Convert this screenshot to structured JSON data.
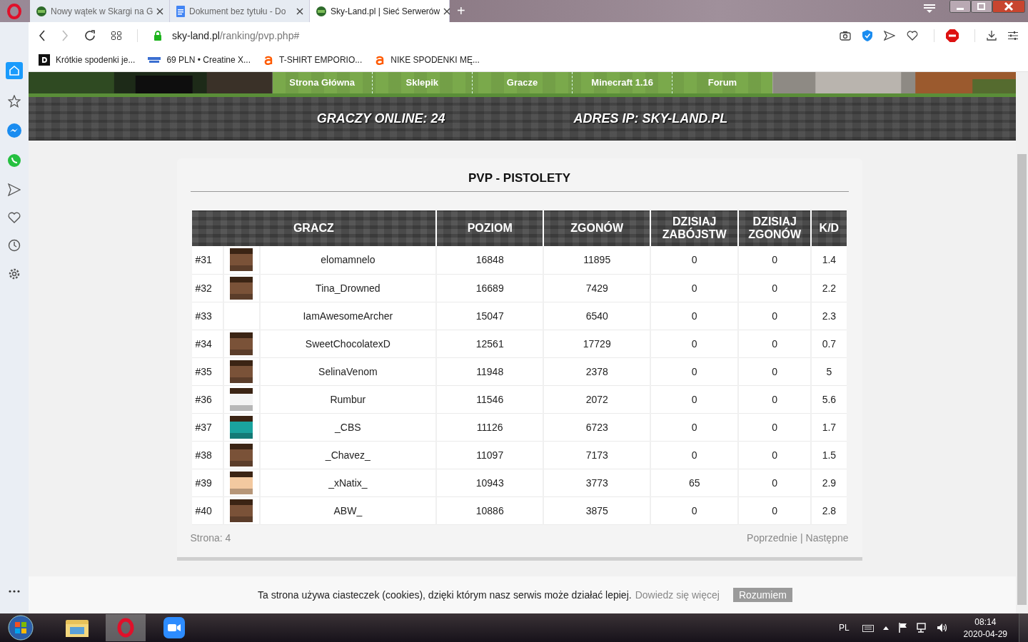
{
  "browser": {
    "tabs": [
      {
        "title": "Nowy wątek w Skargi na G",
        "selected": false
      },
      {
        "title": "Dokument bez tytułu - Do",
        "selected": false
      },
      {
        "title": "Sky-Land.pl | Sieć Serwerów",
        "selected": true
      }
    ],
    "new_tab": "+",
    "address": {
      "host": "sky-land.pl",
      "path": "/ranking/pvp.php#"
    },
    "bookmarks": [
      {
        "title": "Krótkie spodenki je...",
        "kind": "d"
      },
      {
        "title": "69 PLN • Creatine X...",
        "kind": "shop"
      },
      {
        "title": "T-SHIRT EMPORIO...",
        "kind": "a"
      },
      {
        "title": "NIKE SPODENKI MĘ...",
        "kind": "a"
      }
    ]
  },
  "site": {
    "nav": [
      "Strona Główna",
      "Sklepik",
      "Gracze",
      "Minecraft 1.16",
      "Forum"
    ],
    "stats": [
      "GRACZY ONLINE: 24",
      "ADRES IP: SKY-LAND.PL"
    ]
  },
  "ranking": {
    "title": "PVP - PISTOLETY",
    "columns": [
      "GRACZ",
      "POZIOM",
      "ZGONÓW",
      "DZISIAJ ZABÓJSTW",
      "DZISIAJ ZGONÓW",
      "K/D"
    ],
    "rows": [
      {
        "rank": "#31",
        "avatar": {
          "color": "#7a5238"
        },
        "name": "elomamnelo",
        "level": "16848",
        "deaths": "11895",
        "today_kills": "0",
        "today_deaths": "0",
        "kd": "1.4"
      },
      {
        "rank": "#32",
        "avatar": {
          "color": "#7a5238"
        },
        "name": "Tina_Drowned",
        "level": "16689",
        "deaths": "7429",
        "today_kills": "0",
        "today_deaths": "0",
        "kd": "2.2"
      },
      {
        "rank": "#33",
        "name": "IamAwesomeArcher",
        "level": "15047",
        "deaths": "6540",
        "today_kills": "0",
        "today_deaths": "0",
        "kd": "2.3"
      },
      {
        "rank": "#34",
        "avatar": {
          "color": "#7a5238"
        },
        "name": "SweetChocolatexD",
        "level": "12561",
        "deaths": "17729",
        "today_kills": "0",
        "today_deaths": "0",
        "kd": "0.7"
      },
      {
        "rank": "#35",
        "avatar": {
          "color": "#7a5238"
        },
        "name": "SelinaVenom",
        "level": "11948",
        "deaths": "2378",
        "today_kills": "0",
        "today_deaths": "0",
        "kd": "5"
      },
      {
        "rank": "#36",
        "avatar": {
          "color": "#f4f4f4"
        },
        "name": "Rumbur",
        "level": "11546",
        "deaths": "2072",
        "today_kills": "0",
        "today_deaths": "0",
        "kd": "5.6"
      },
      {
        "rank": "#37",
        "avatar": {
          "color": "#1aa39e"
        },
        "name": "_CBS",
        "level": "11126",
        "deaths": "6723",
        "today_kills": "0",
        "today_deaths": "0",
        "kd": "1.7"
      },
      {
        "rank": "#38",
        "avatar": {
          "color": "#7a5238"
        },
        "name": "_Chavez_",
        "level": "11097",
        "deaths": "7173",
        "today_kills": "0",
        "today_deaths": "0",
        "kd": "1.5"
      },
      {
        "rank": "#39",
        "avatar": {
          "color": "#f3c9a0"
        },
        "name": "_xNatix_",
        "level": "10943",
        "deaths": "3773",
        "today_kills": "65",
        "today_deaths": "0",
        "kd": "2.9"
      },
      {
        "rank": "#40",
        "avatar": {
          "color": "#7a5238"
        },
        "name": "ABW_",
        "level": "10886",
        "deaths": "3875",
        "today_kills": "0",
        "today_deaths": "0",
        "kd": "2.8"
      }
    ],
    "page": "Strona: 4",
    "prev": "Poprzednie",
    "separator": "|",
    "next": "Następne"
  },
  "cookie_bar": {
    "text": "Ta strona używa ciasteczek (cookies), dzięki którym nasz serwis może działać lepiej.",
    "link": "Dowiedz się więcej",
    "button": "Rozumiem"
  },
  "taskbar": {
    "language": "PL",
    "time": "08:14",
    "date": "2020-04-29"
  }
}
